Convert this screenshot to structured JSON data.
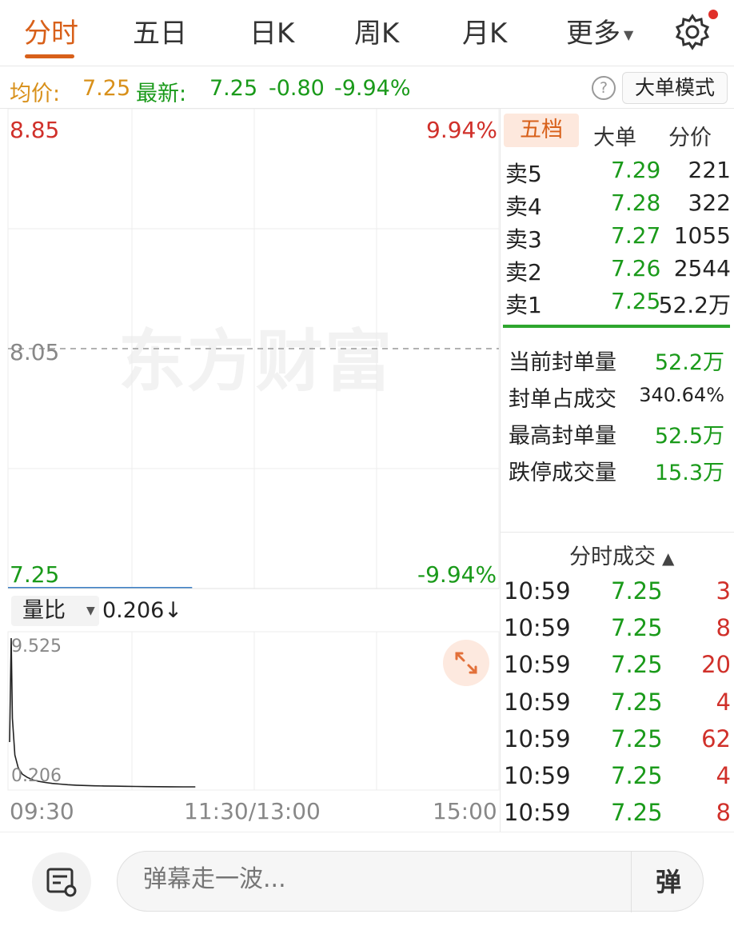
{
  "tabs": [
    "分时",
    "五日",
    "日K",
    "周K",
    "月K",
    "更多"
  ],
  "info": {
    "avg_label": "均价:",
    "avg_value": "7.25",
    "latest_label": "最新:",
    "latest_value": "7.25",
    "change": "-0.80",
    "change_pct": "-9.94%",
    "help": "?",
    "mode_button": "大单模式"
  },
  "chart": {
    "y_top": "8.85",
    "y_mid": "8.05",
    "y_bottom": "7.25",
    "pct_top": "9.94%",
    "pct_bottom": "-9.94%",
    "watermark": "东方财富",
    "vol_selector": "量比",
    "vol_value": "0.206↓",
    "vol_top": "9.525",
    "vol_bottom": "0.206",
    "x_labels": [
      "09:30",
      "11:30/13:00",
      "15:00"
    ]
  },
  "chart_data": {
    "type": "line",
    "price_ylim": [
      7.25,
      8.85
    ],
    "price_ref": 8.05,
    "price_series": [
      7.25,
      7.25,
      7.25,
      7.25,
      7.25,
      7.25,
      7.25,
      7.25,
      7.25,
      7.25
    ],
    "volume_ratio_ylim": [
      0.206,
      9.525
    ],
    "volume_ratio_series": [
      9.525,
      4.5,
      2.2,
      1.4,
      1.0,
      0.8,
      0.65,
      0.55,
      0.48,
      0.42,
      0.38,
      0.34,
      0.31,
      0.29,
      0.27,
      0.26,
      0.25,
      0.24,
      0.23,
      0.22,
      0.215,
      0.21,
      0.208,
      0.206
    ],
    "x_labels": [
      "09:30",
      "11:30/13:00",
      "15:00"
    ]
  },
  "panel": {
    "tabs": [
      "五档",
      "大单",
      "分价"
    ],
    "orderbook": [
      {
        "label": "卖5",
        "price": "7.29",
        "vol": "221"
      },
      {
        "label": "卖4",
        "price": "7.28",
        "vol": "322"
      },
      {
        "label": "卖3",
        "price": "7.27",
        "vol": "1055"
      },
      {
        "label": "卖2",
        "price": "7.26",
        "vol": "2544"
      },
      {
        "label": "卖1",
        "price": "7.25",
        "vol": "52.2万"
      }
    ],
    "stats": [
      {
        "label": "当前封单量",
        "value": "52.2万"
      },
      {
        "label": "封单占成交",
        "value": "340.64%"
      },
      {
        "label": "最高封单量",
        "value": "52.5万"
      },
      {
        "label": "跌停成交量",
        "value": "15.3万"
      }
    ],
    "trades_title": "分时成交",
    "trades": [
      {
        "time": "10:59",
        "price": "7.25",
        "vol": "3"
      },
      {
        "time": "10:59",
        "price": "7.25",
        "vol": "8"
      },
      {
        "time": "10:59",
        "price": "7.25",
        "vol": "20"
      },
      {
        "time": "10:59",
        "price": "7.25",
        "vol": "4"
      },
      {
        "time": "10:59",
        "price": "7.25",
        "vol": "62"
      },
      {
        "time": "10:59",
        "price": "7.25",
        "vol": "4"
      },
      {
        "time": "10:59",
        "price": "7.25",
        "vol": "8"
      }
    ]
  },
  "bottom": {
    "placeholder": "弹幕走一波...",
    "send": "弹"
  }
}
